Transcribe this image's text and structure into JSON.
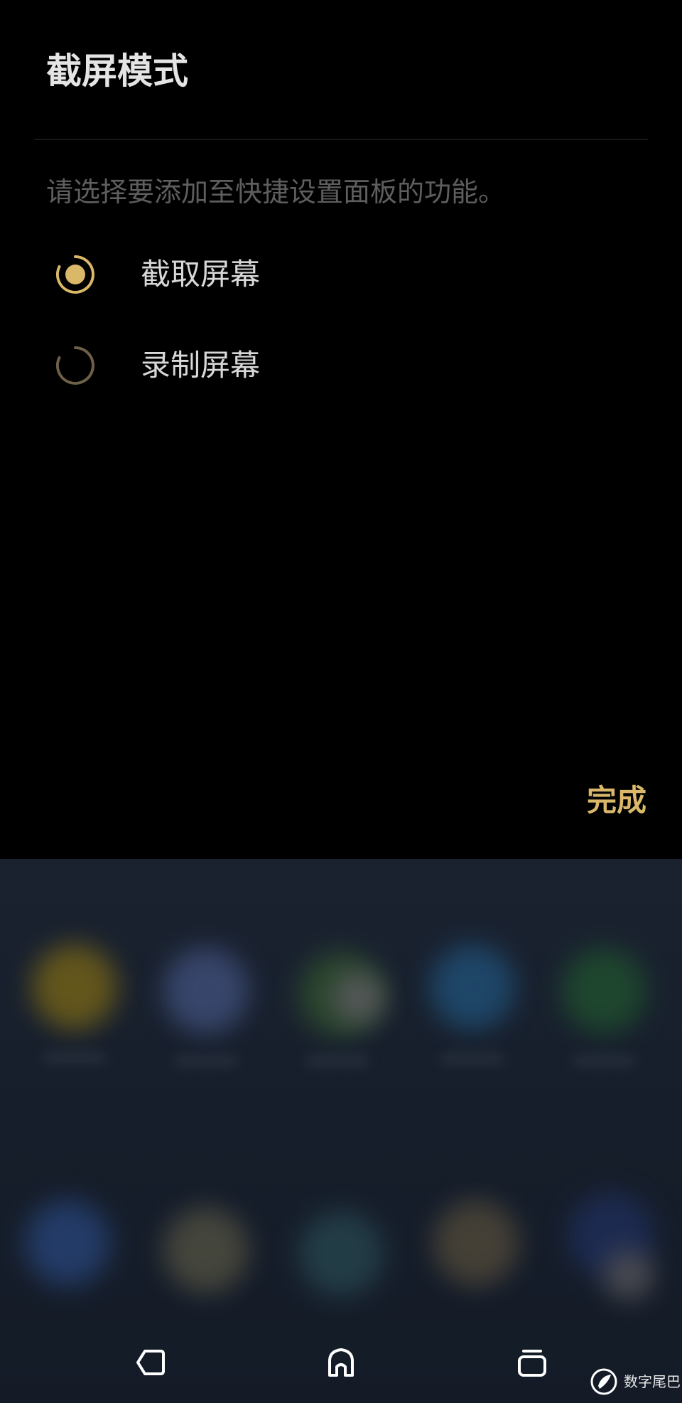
{
  "dialog": {
    "title": "截屏模式",
    "description": "请选择要添加至快捷设置面板的功能。",
    "options": [
      {
        "label": "截取屏幕",
        "selected": true
      },
      {
        "label": "录制屏幕",
        "selected": false
      }
    ],
    "done_label": "完成"
  },
  "colors": {
    "accent": "#d9b86a",
    "background": "#000000"
  },
  "nav": {
    "back_icon": "back-icon",
    "home_icon": "home-icon",
    "recents_icon": "recents-icon"
  },
  "watermark": {
    "text": "数字尾巴"
  }
}
